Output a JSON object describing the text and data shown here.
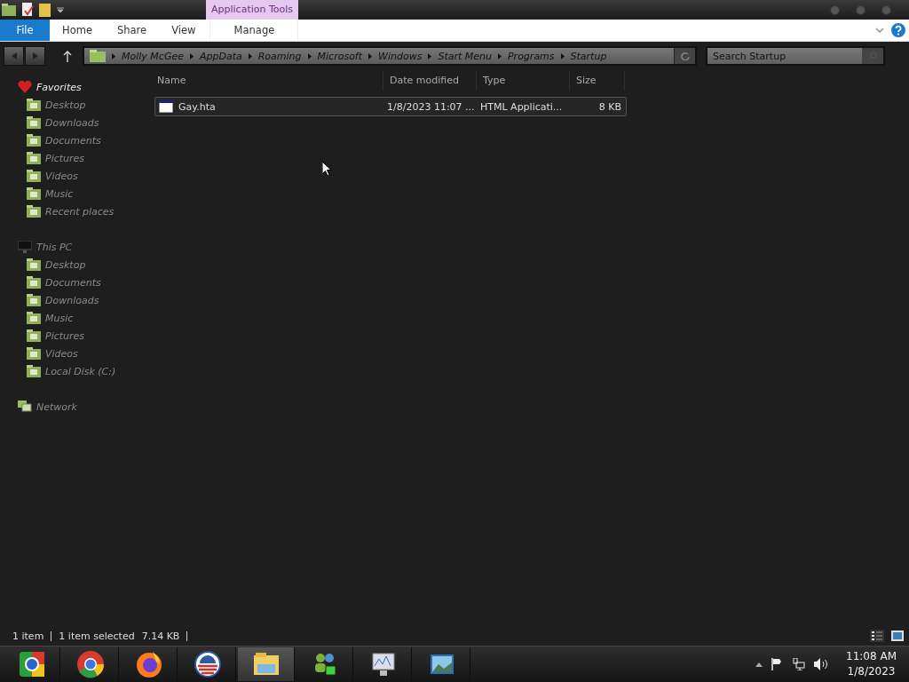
{
  "title_bar": {
    "context_tab": "Application Tools"
  },
  "ribbon": {
    "tabs": [
      {
        "label": "File",
        "kind": "file",
        "selected": false
      },
      {
        "label": "Home",
        "kind": "tab",
        "selected": false
      },
      {
        "label": "Share",
        "kind": "tab",
        "selected": false
      },
      {
        "label": "View",
        "kind": "tab",
        "selected": false
      },
      {
        "label": "Manage",
        "kind": "context",
        "selected": false
      }
    ]
  },
  "address_bar": {
    "path": [
      "Molly McGee",
      "AppData",
      "Roaming",
      "Microsoft",
      "Windows",
      "Start Menu",
      "Programs",
      "Startup"
    ]
  },
  "search": {
    "placeholder": "Search Startup"
  },
  "sidebar": {
    "groups": [
      {
        "label": "Favorites",
        "children": [
          {
            "label": "Desktop"
          },
          {
            "label": "Downloads"
          },
          {
            "label": "Documents"
          },
          {
            "label": "Pictures"
          },
          {
            "label": "Videos"
          },
          {
            "label": "Music"
          },
          {
            "label": "Recent places"
          }
        ]
      },
      {
        "label": "This PC",
        "children": [
          {
            "label": "Desktop"
          },
          {
            "label": "Documents"
          },
          {
            "label": "Downloads"
          },
          {
            "label": "Music"
          },
          {
            "label": "Pictures"
          },
          {
            "label": "Videos"
          },
          {
            "label": "Local Disk (C:)"
          }
        ]
      },
      {
        "label": "Network"
      }
    ]
  },
  "table": {
    "columns": [
      "Name",
      "Date modified",
      "Type",
      "Size"
    ],
    "rows": [
      {
        "name": "Gay.hta",
        "date_modified": "1/8/2023 11:07 ...",
        "type": "HTML Applicati...",
        "size": "8 KB",
        "selected": true
      }
    ]
  },
  "status_bar": {
    "count": "1 item",
    "selection": "1 item selected",
    "size": "7.14 KB"
  },
  "taskbar": {
    "apps": [
      {
        "selected": false
      },
      {
        "selected": false
      },
      {
        "selected": false
      },
      {
        "selected": false
      },
      {
        "selected": true
      },
      {
        "selected": false
      },
      {
        "selected": false
      },
      {
        "selected": false
      }
    ],
    "clock": {
      "time": "11:08 AM",
      "date": "1/8/2023"
    }
  }
}
